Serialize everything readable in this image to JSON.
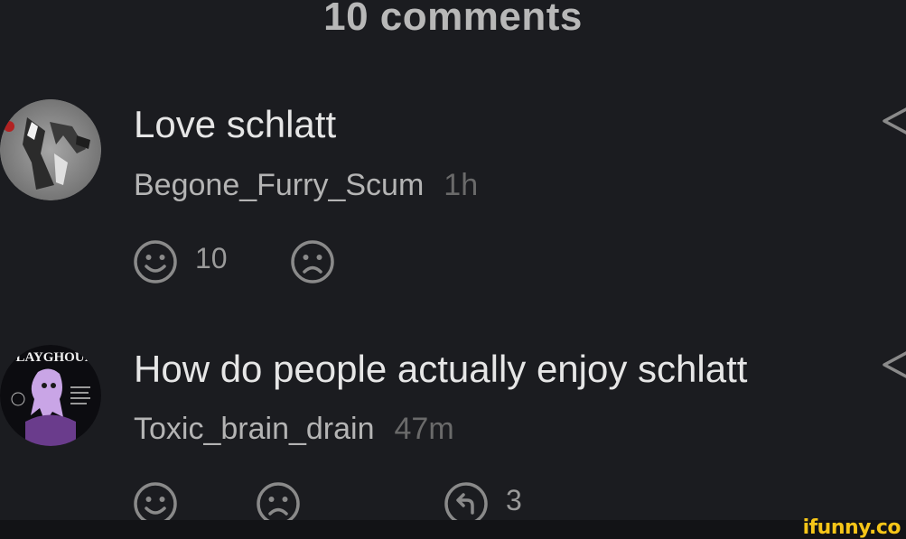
{
  "header": {
    "title": "10 comments"
  },
  "comments": [
    {
      "text": "Love schlatt",
      "username": "Begone_Furry_Scum",
      "time": "1h",
      "likes": "10"
    },
    {
      "text": "How do people actually enjoy schlatt",
      "username": "Toxic_brain_drain",
      "time": "47m",
      "replies": "3",
      "avatar_text": "PLAYGHOUL"
    }
  ],
  "watermark": "ifunny.co",
  "colors": {
    "background": "#1b1c20",
    "text": "#e6e6e6",
    "muted": "#6a6a6a",
    "brand": "#f5c518"
  }
}
